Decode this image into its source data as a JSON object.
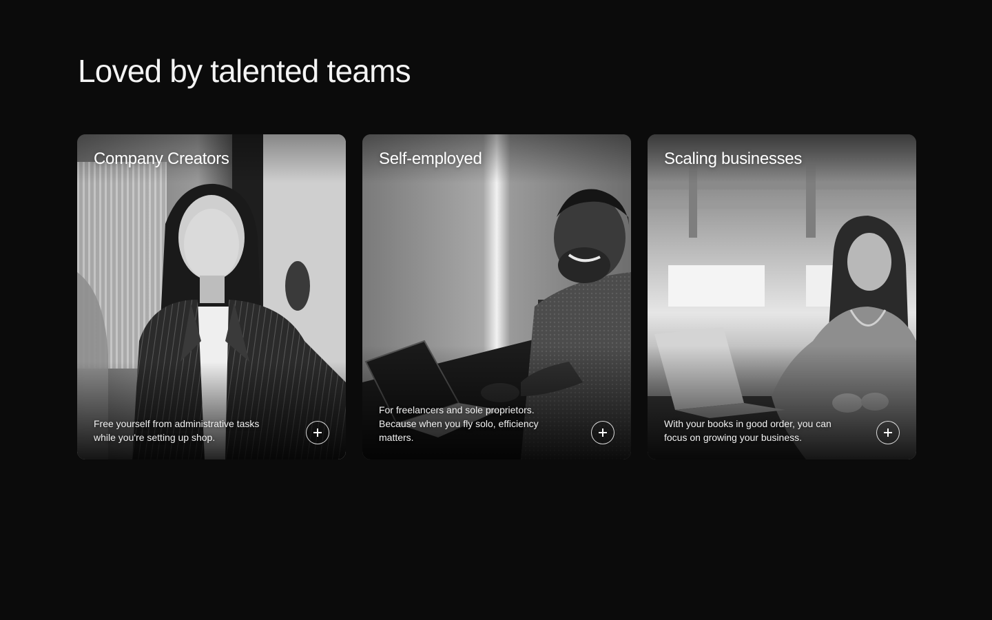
{
  "section": {
    "heading": "Loved by talented teams"
  },
  "cards": [
    {
      "title": "Company Creators",
      "description": "Free yourself from administrative tasks while you're setting up shop.",
      "image": "woman-in-pinstripe-blazer-photo",
      "action_icon": "plus-icon"
    },
    {
      "title": "Self-employed",
      "description": "For freelancers and sole proprietors. Because when you fly solo, efficiency matters.",
      "image": "man-at-laptop-photo",
      "action_icon": "plus-icon"
    },
    {
      "title": "Scaling businesses",
      "description": "With your books in good order, you can focus on growing your business.",
      "image": "woman-in-open-office-photo",
      "action_icon": "plus-icon"
    }
  ],
  "colors": {
    "background": "#0b0b0b",
    "text": "#ffffff",
    "card_tone": "grayscale"
  }
}
